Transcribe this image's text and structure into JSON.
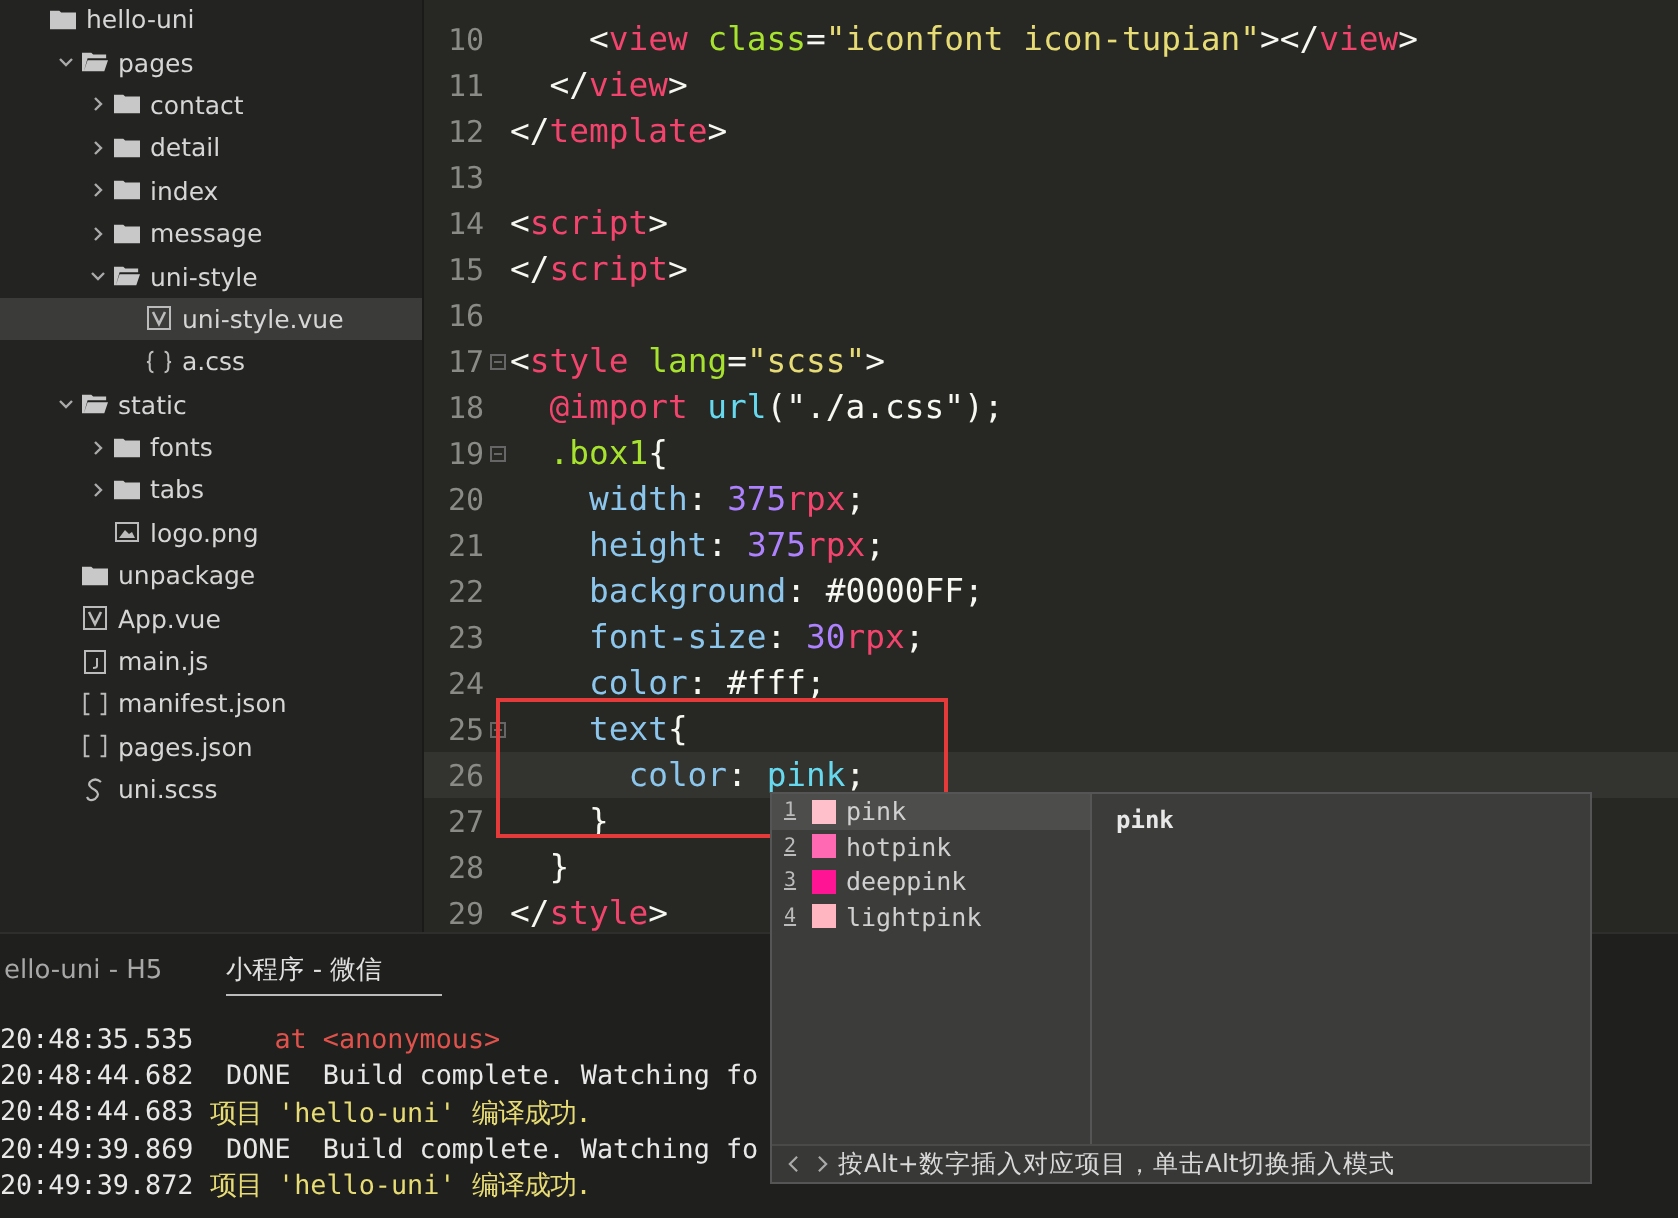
{
  "sidebar": {
    "tree": [
      {
        "label": "hello-uni",
        "kind": "project",
        "selected": false,
        "children": [
          {
            "label": "pages",
            "kind": "folder",
            "expanded": true,
            "selected": false,
            "children": [
              {
                "label": "contact",
                "kind": "folder",
                "expanded": false,
                "selected": false
              },
              {
                "label": "detail",
                "kind": "folder",
                "expanded": false,
                "selected": false
              },
              {
                "label": "index",
                "kind": "folder",
                "expanded": false,
                "selected": false
              },
              {
                "label": "message",
                "kind": "folder",
                "expanded": false,
                "selected": false
              },
              {
                "label": "uni-style",
                "kind": "folder",
                "expanded": true,
                "selected": false,
                "children": [
                  {
                    "label": "uni-style.vue",
                    "kind": "vue",
                    "selected": true
                  },
                  {
                    "label": "a.css",
                    "kind": "css",
                    "selected": false
                  }
                ]
              }
            ]
          },
          {
            "label": "static",
            "kind": "folder",
            "expanded": true,
            "selected": false,
            "children": [
              {
                "label": "fonts",
                "kind": "folder",
                "expanded": false,
                "selected": false
              },
              {
                "label": "tabs",
                "kind": "folder",
                "expanded": false,
                "selected": false
              },
              {
                "label": "logo.png",
                "kind": "image",
                "selected": false
              }
            ]
          },
          {
            "label": "unpackage",
            "kind": "folder",
            "selected": false
          },
          {
            "label": "App.vue",
            "kind": "vue",
            "selected": false
          },
          {
            "label": "main.js",
            "kind": "js",
            "selected": false
          },
          {
            "label": "manifest.json",
            "kind": "json",
            "selected": false
          },
          {
            "label": "pages.json",
            "kind": "json",
            "selected": false
          },
          {
            "label": "uni.scss",
            "kind": "scss",
            "selected": false
          }
        ]
      }
    ]
  },
  "editor": {
    "lines": [
      {
        "number": "10",
        "fold": false,
        "current": false,
        "tokens": [
          {
            "kind": "punct",
            "text": "    <"
          },
          {
            "kind": "tag",
            "text": "view"
          },
          {
            "kind": "attr",
            "text": " class"
          },
          {
            "kind": "punct",
            "text": "="
          },
          {
            "kind": "string",
            "text": "\"iconfont icon-tupian\""
          },
          {
            "kind": "punct",
            "text": "></"
          },
          {
            "kind": "tag",
            "text": "view"
          },
          {
            "kind": "punct",
            "text": ">"
          }
        ]
      },
      {
        "number": "11",
        "fold": false,
        "current": false,
        "tokens": [
          {
            "kind": "punct",
            "text": "  </"
          },
          {
            "kind": "tag",
            "text": "view"
          },
          {
            "kind": "punct",
            "text": ">"
          }
        ]
      },
      {
        "number": "12",
        "fold": false,
        "current": false,
        "tokens": [
          {
            "kind": "punct",
            "text": "</"
          },
          {
            "kind": "tag",
            "text": "template"
          },
          {
            "kind": "punct",
            "text": ">"
          }
        ]
      },
      {
        "number": "13",
        "fold": false,
        "current": false
      },
      {
        "number": "14",
        "fold": false,
        "current": false,
        "tokens": [
          {
            "kind": "punct",
            "text": "<"
          },
          {
            "kind": "tag",
            "text": "script"
          },
          {
            "kind": "punct",
            "text": ">"
          }
        ]
      },
      {
        "number": "15",
        "fold": false,
        "current": false,
        "tokens": [
          {
            "kind": "punct",
            "text": "</"
          },
          {
            "kind": "tag",
            "text": "script"
          },
          {
            "kind": "punct",
            "text": ">"
          }
        ]
      },
      {
        "number": "16",
        "fold": false,
        "current": false
      },
      {
        "number": "17",
        "fold": true,
        "current": false,
        "tokens": [
          {
            "kind": "punct",
            "text": "<"
          },
          {
            "kind": "tag",
            "text": "style"
          },
          {
            "kind": "attr",
            "text": " lang"
          },
          {
            "kind": "punct",
            "text": "="
          },
          {
            "kind": "string",
            "text": "\"scss\""
          },
          {
            "kind": "punct",
            "text": ">"
          }
        ]
      },
      {
        "number": "18",
        "fold": false,
        "current": false,
        "tokens": [
          {
            "kind": "tag",
            "text": "  @import"
          },
          {
            "kind": "func",
            "text": " url"
          },
          {
            "kind": "punct",
            "text": "(\"./a.css\");"
          }
        ]
      },
      {
        "number": "19",
        "fold": true,
        "current": false,
        "tokens": [
          {
            "kind": "attr",
            "text": "  .box1"
          },
          {
            "kind": "punct",
            "text": "{"
          }
        ]
      },
      {
        "number": "20",
        "fold": false,
        "current": false,
        "tokens": [
          {
            "kind": "prop",
            "text": "    width"
          },
          {
            "kind": "punct",
            "text": ": "
          },
          {
            "kind": "number",
            "text": "375"
          },
          {
            "kind": "tag",
            "text": "rpx"
          },
          {
            "kind": "punct",
            "text": ";"
          }
        ]
      },
      {
        "number": "21",
        "fold": false,
        "current": false,
        "tokens": [
          {
            "kind": "prop",
            "text": "    height"
          },
          {
            "kind": "punct",
            "text": ": "
          },
          {
            "kind": "number",
            "text": "375"
          },
          {
            "kind": "tag",
            "text": "rpx"
          },
          {
            "kind": "punct",
            "text": ";"
          }
        ]
      },
      {
        "number": "22",
        "fold": false,
        "current": false,
        "tokens": [
          {
            "kind": "prop",
            "text": "    background"
          },
          {
            "kind": "punct",
            "text": ": #0000FF;"
          }
        ]
      },
      {
        "number": "23",
        "fold": false,
        "current": false,
        "tokens": [
          {
            "kind": "prop",
            "text": "    font-size"
          },
          {
            "kind": "punct",
            "text": ": "
          },
          {
            "kind": "number",
            "text": "30"
          },
          {
            "kind": "tag",
            "text": "rpx"
          },
          {
            "kind": "punct",
            "text": ";"
          }
        ]
      },
      {
        "number": "24",
        "fold": false,
        "current": false,
        "tokens": [
          {
            "kind": "prop",
            "text": "    color"
          },
          {
            "kind": "punct",
            "text": ": #fff;"
          }
        ]
      },
      {
        "number": "25",
        "fold": true,
        "current": false,
        "tokens": [
          {
            "kind": "prop",
            "text": "    text"
          },
          {
            "kind": "punct",
            "text": "{"
          }
        ]
      },
      {
        "number": "26",
        "fold": false,
        "current": true,
        "tokens": [
          {
            "kind": "prop",
            "text": "      color"
          },
          {
            "kind": "punct",
            "text": ": "
          },
          {
            "kind": "func",
            "text": "pink"
          },
          {
            "kind": "punct",
            "text": ";"
          }
        ]
      },
      {
        "number": "27",
        "fold": false,
        "current": false,
        "tokens": [
          {
            "kind": "punct",
            "text": "    }"
          }
        ]
      },
      {
        "number": "28",
        "fold": false,
        "current": false,
        "tokens": [
          {
            "kind": "punct",
            "text": "  }"
          }
        ]
      },
      {
        "number": "29",
        "fold": false,
        "current": false,
        "tokens": [
          {
            "kind": "punct",
            "text": "</"
          },
          {
            "kind": "tag",
            "text": "style"
          },
          {
            "kind": "punct",
            "text": ">"
          }
        ]
      }
    ]
  },
  "autocomplete": {
    "items": [
      {
        "number": "1",
        "label": "pink",
        "color": "#ffc0cb",
        "selected": true
      },
      {
        "number": "2",
        "label": "hotpink",
        "color": "#ff69b4",
        "selected": false
      },
      {
        "number": "3",
        "label": "deeppink",
        "color": "#ff1493",
        "selected": false
      },
      {
        "number": "4",
        "label": "lightpink",
        "color": "#ffb6c1",
        "selected": false
      }
    ],
    "detail": "pink",
    "hint": "按Alt+数字插入对应项目，单击Alt切换插入模式"
  },
  "console": {
    "tabs": [
      {
        "label": "ello-uni - H5",
        "selected": false
      },
      {
        "label": "小程序 - 微信",
        "selected": true
      }
    ],
    "lines": [
      {
        "time": "20:48:35.535",
        "kind": "trace",
        "message": "    at <anonymous>"
      },
      {
        "time": "20:48:44.682",
        "kind": "done",
        "message": " DONE  Build complete. Watching fo"
      },
      {
        "time": "20:48:44.683",
        "kind": "success",
        "message": "项目 'hello-uni' 编译成功."
      },
      {
        "time": "20:49:39.869",
        "kind": "done",
        "message": " DONE  Build complete. Watching fo"
      },
      {
        "time": "20:49:39.872",
        "kind": "success",
        "message": "项目 'hello-uni' 编译成功."
      }
    ]
  }
}
